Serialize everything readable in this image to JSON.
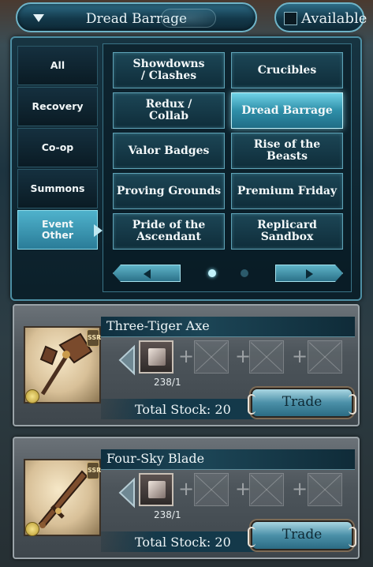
{
  "top_bar": {
    "event_select_label": "Dread Barrage",
    "available_label": "Available"
  },
  "categories": [
    {
      "label": "All"
    },
    {
      "label": "Recovery"
    },
    {
      "label": "Co-op"
    },
    {
      "label": "Summons"
    },
    {
      "label": "Event Other",
      "selected": true
    }
  ],
  "event_buttons": [
    {
      "label": "Showdowns / Clashes"
    },
    {
      "label": "Crucibles"
    },
    {
      "label": "Redux / Collab"
    },
    {
      "label": "Dread Barrage",
      "selected": true
    },
    {
      "label": "Valor Badges"
    },
    {
      "label": "Rise of the Beasts"
    },
    {
      "label": "Proving Grounds"
    },
    {
      "label": "Premium Friday"
    },
    {
      "label": "Pride of the Ascendant"
    },
    {
      "label": "Replicard Sandbox"
    }
  ],
  "pagination": {
    "current_page": 1,
    "total_pages": 2
  },
  "items": [
    {
      "name": "Three-Tiger Axe",
      "rarity": "SSR",
      "material_qty": "238/1",
      "stock": "Total Stock: 20",
      "trade_label": "Trade"
    },
    {
      "name": "Four-Sky Blade",
      "rarity": "SSR",
      "material_qty": "238/1",
      "stock": "Total Stock: 20",
      "trade_label": "Trade"
    }
  ]
}
